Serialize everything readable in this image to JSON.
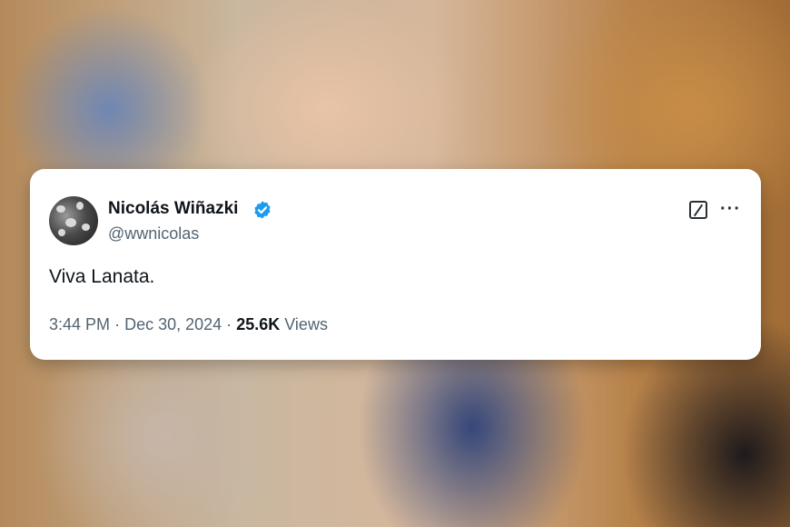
{
  "tweet": {
    "author_name": "Nicolás Wiñazki",
    "handle": "@wwnicolas",
    "text": "Viva Lanata.",
    "time": "3:44 PM",
    "separator": "·",
    "date": "Dec 30, 2024",
    "views_count": "25.6K",
    "views_label": "Views"
  },
  "icons": {
    "verified": "verified-badge-icon",
    "grok": "grok-icon",
    "more": "more-options-icon"
  },
  "colors": {
    "verified_blue": "#1d9bf0",
    "text_primary": "#0f1419",
    "text_secondary": "#536471"
  }
}
